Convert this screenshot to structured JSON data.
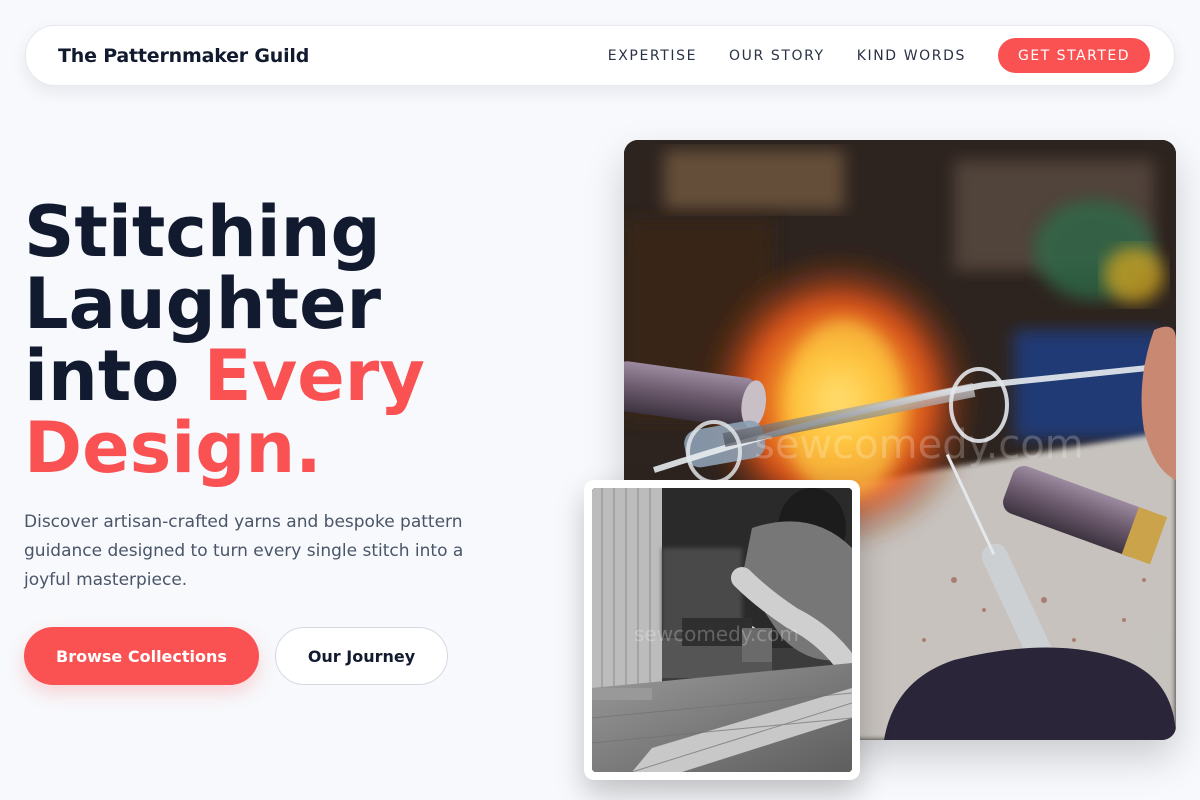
{
  "nav": {
    "brand": "The Patternmaker Guild",
    "links": [
      {
        "label": "EXPERTISE"
      },
      {
        "label": "OUR STORY"
      },
      {
        "label": "KIND WORDS"
      }
    ],
    "cta": "GET STARTED"
  },
  "hero": {
    "title_line1": "Stitching",
    "title_line2": "Laughter",
    "title_line3a": "into ",
    "title_line3b": "Every",
    "title_line4": "Design.",
    "description": "Discover artisan-crafted yarns and bespoke pattern guidance designed to turn every single stitch into a joyful masterpiece.",
    "primary_button": "Browse Collections",
    "secondary_button": "Our Journey"
  },
  "images": {
    "main_watermark": "sewcomedy.com",
    "inset_watermark": "sewcomedy.com"
  },
  "colors": {
    "accent": "#fa5252",
    "heading": "#111a2e",
    "body_text": "#4a5568",
    "background": "#f7f9fc"
  }
}
